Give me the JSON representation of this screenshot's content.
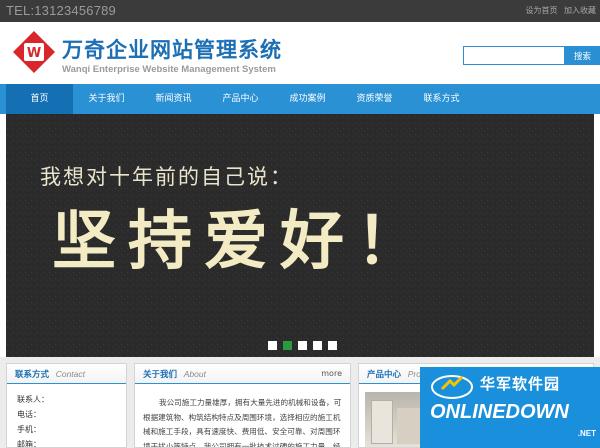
{
  "topbar": {
    "tel": "TEL:13123456789",
    "links": [
      "设为首页",
      "加入收藏"
    ]
  },
  "header": {
    "title": "万奇企业网站管理系统",
    "subtitle": "Wanqi Enterprise Website Management System",
    "search_placeholder": "",
    "search_button": "搜索"
  },
  "nav": {
    "items": [
      "首页",
      "关于我们",
      "新闻资讯",
      "产品中心",
      "成功案例",
      "资质荣誉",
      "联系方式"
    ],
    "active_index": 0
  },
  "banner": {
    "line1": "我想对十年前的自己说：",
    "line2": "坚持爱好！",
    "slide_count": 5,
    "active_slide": 1
  },
  "panels": {
    "contact": {
      "title": "联系方式",
      "subtitle": "Contact",
      "rows": [
        "联系人：",
        "电话：",
        "手机：",
        "邮箱："
      ]
    },
    "about": {
      "title": "关于我们",
      "subtitle": "About",
      "more": "more",
      "text": "我公司施工力量雄厚，拥有大量先进的机械和设备，可根据建筑物、构筑结构特点及周围环境，选择相应的施工机械和施工手段，具有速度快、费用低、安全可靠、对周围环境干扰小等特点。我公司拥有一批技术过硬的施工力量，经验丰富的工程技术人员"
    },
    "products": {
      "title": "产品中心",
      "subtitle": "Pro"
    }
  },
  "watermark": {
    "cn": "华军软件园",
    "en": "ONLINEDOWN",
    "url": ".NET"
  },
  "colors": {
    "accent": "#2a91d5",
    "nav_active": "#1470b3",
    "title_blue": "#1c6fb4",
    "logo_red": "#d8262c",
    "banner_bg": "#2c2c2c"
  }
}
